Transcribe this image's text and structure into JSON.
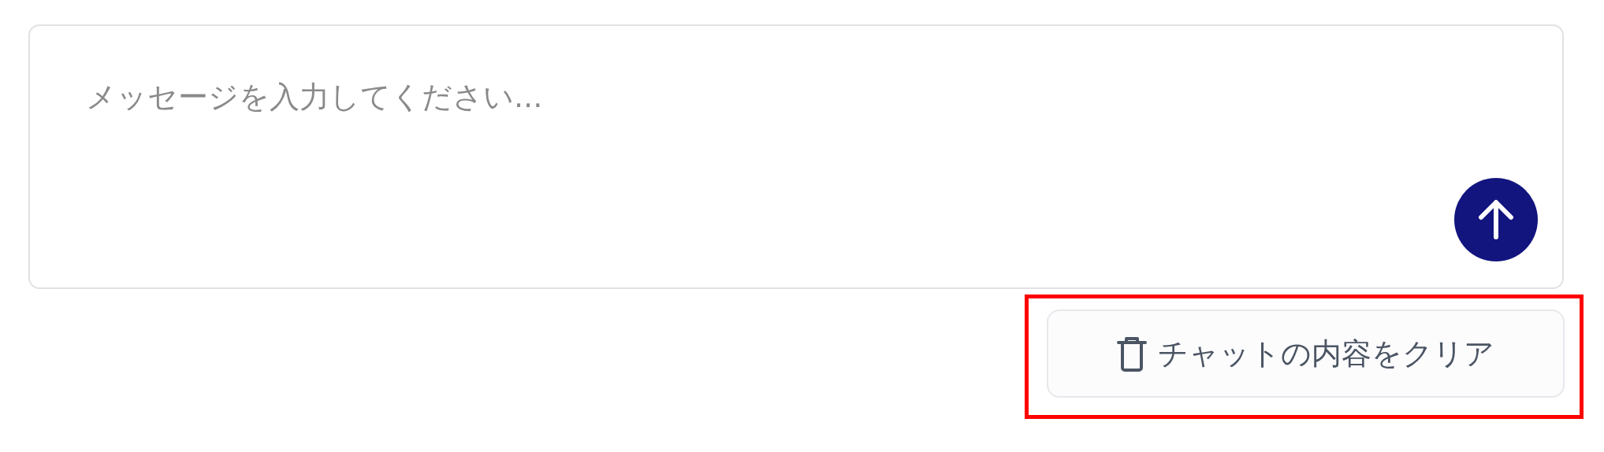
{
  "message_input": {
    "placeholder": "メッセージを入力してください..."
  },
  "clear_button": {
    "label": "チャットの内容をクリア",
    "highlighted": true
  }
}
